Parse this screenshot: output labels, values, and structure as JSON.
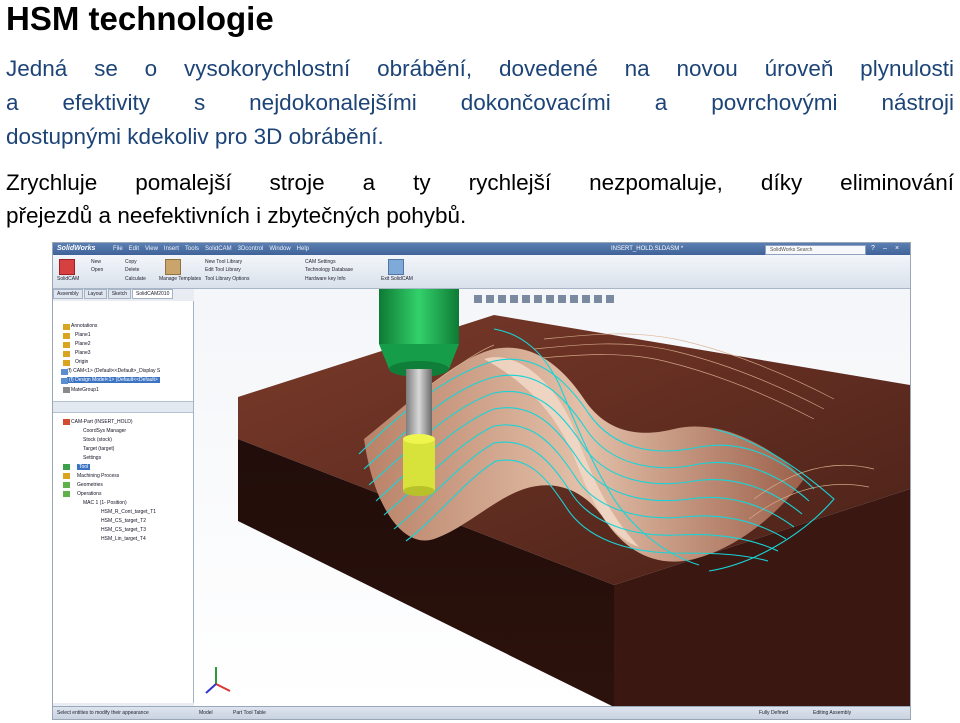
{
  "slide": {
    "title": "HSM technologie",
    "para1": [
      "Jedná se o vysokorychlostní obrábění, dovedené na novou úroveň plynulosti",
      "a efektivity s nejdokonalejšími dokončovacími a povrchovými nástroji",
      "dostupnými kdekoliv pro 3D obrábění."
    ],
    "para2": [
      "Zrychluje pomalejší stroje a ty rychlejší nezpomaluje, díky eliminování",
      "přejezdů a neefektivních i zbytečných pohybů."
    ]
  },
  "colors": {
    "accent_text": "#1d4477",
    "stock": "#5a2a1f",
    "toolpath": "#18d4d8",
    "tool": "#19a84a"
  },
  "screenshot": {
    "app_name": "SolidWorks",
    "menu": [
      "File",
      "Edit",
      "View",
      "Insert",
      "Tools",
      "SolidCAM",
      "3Dcontrol",
      "Window",
      "Help"
    ],
    "doc_title": "INSERT_HOLD.SLDASM *",
    "search_placeholder": "SolidWorks Search",
    "ribbon": {
      "solidcam": "SolidCAM",
      "new": "New",
      "open": "Open",
      "copy": "Copy",
      "delete": "Delete",
      "calculate": "Calculate",
      "manage_templates": "Manage Templates",
      "new_tool_library": "New Tool Library",
      "edit_tool_library": "Edit Tool Library",
      "tool_library_options": "Tool Library Options",
      "cam_settings": "CAM Settings",
      "technology_database": "Technology Database",
      "hardware_key_info": "Hardware key Info",
      "exit_solidcam": "Exit SolidCAM"
    },
    "tabs": [
      "Assembly",
      "Layout",
      "Sketch",
      "SolidCAM2010"
    ],
    "tree_top": [
      "Annotations",
      "Plane1",
      "Plane2",
      "Plane3",
      "Origin",
      "(f) CAM<1> (Default<<Default>_Display S",
      "(f) Design Model<1> (Default<<Default>"
    ],
    "tree_bottom": [
      "MateGroup1",
      "CAM-Part (INSERT_HOLD)",
      "CoordSys Manager",
      "Stock (stock)",
      "Target (target)",
      "Settings",
      "Tool",
      "Machining Process",
      "Geometries",
      "Operations",
      "MAC 1 (1- Position)",
      "HSM_R_Cont_target_T1",
      "HSM_CS_target_T2",
      "HSM_CS_target_T3",
      "HSM_Lin_target_T4"
    ],
    "status": {
      "left": "Select entities to modify their appearance",
      "model_tab": "Model",
      "part_tool_table": "Part Tool Table",
      "fully_defined": "Fully Defined",
      "editing": "Editing Assembly"
    }
  }
}
